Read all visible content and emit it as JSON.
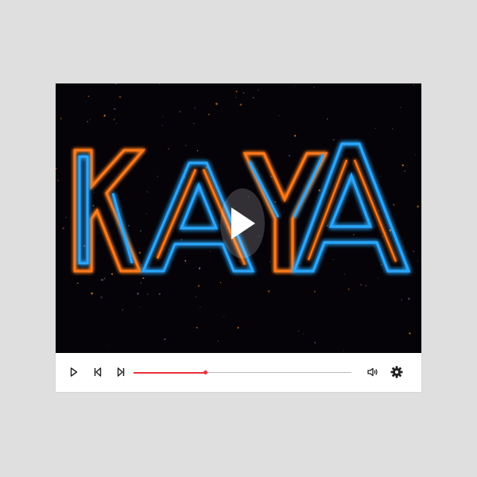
{
  "video": {
    "title_art_text": "KAYA",
    "colors": {
      "background": "#050308",
      "glow_orange": "#ff7a1a",
      "glow_blue": "#2aa7ff"
    }
  },
  "controls": {
    "play_icon": "play-icon",
    "prev_icon": "skip-previous-icon",
    "next_icon": "skip-next-icon",
    "volume_icon": "volume-icon",
    "settings_icon": "gear-icon",
    "progress_fraction": 0.33,
    "accent": "#e8323c"
  }
}
